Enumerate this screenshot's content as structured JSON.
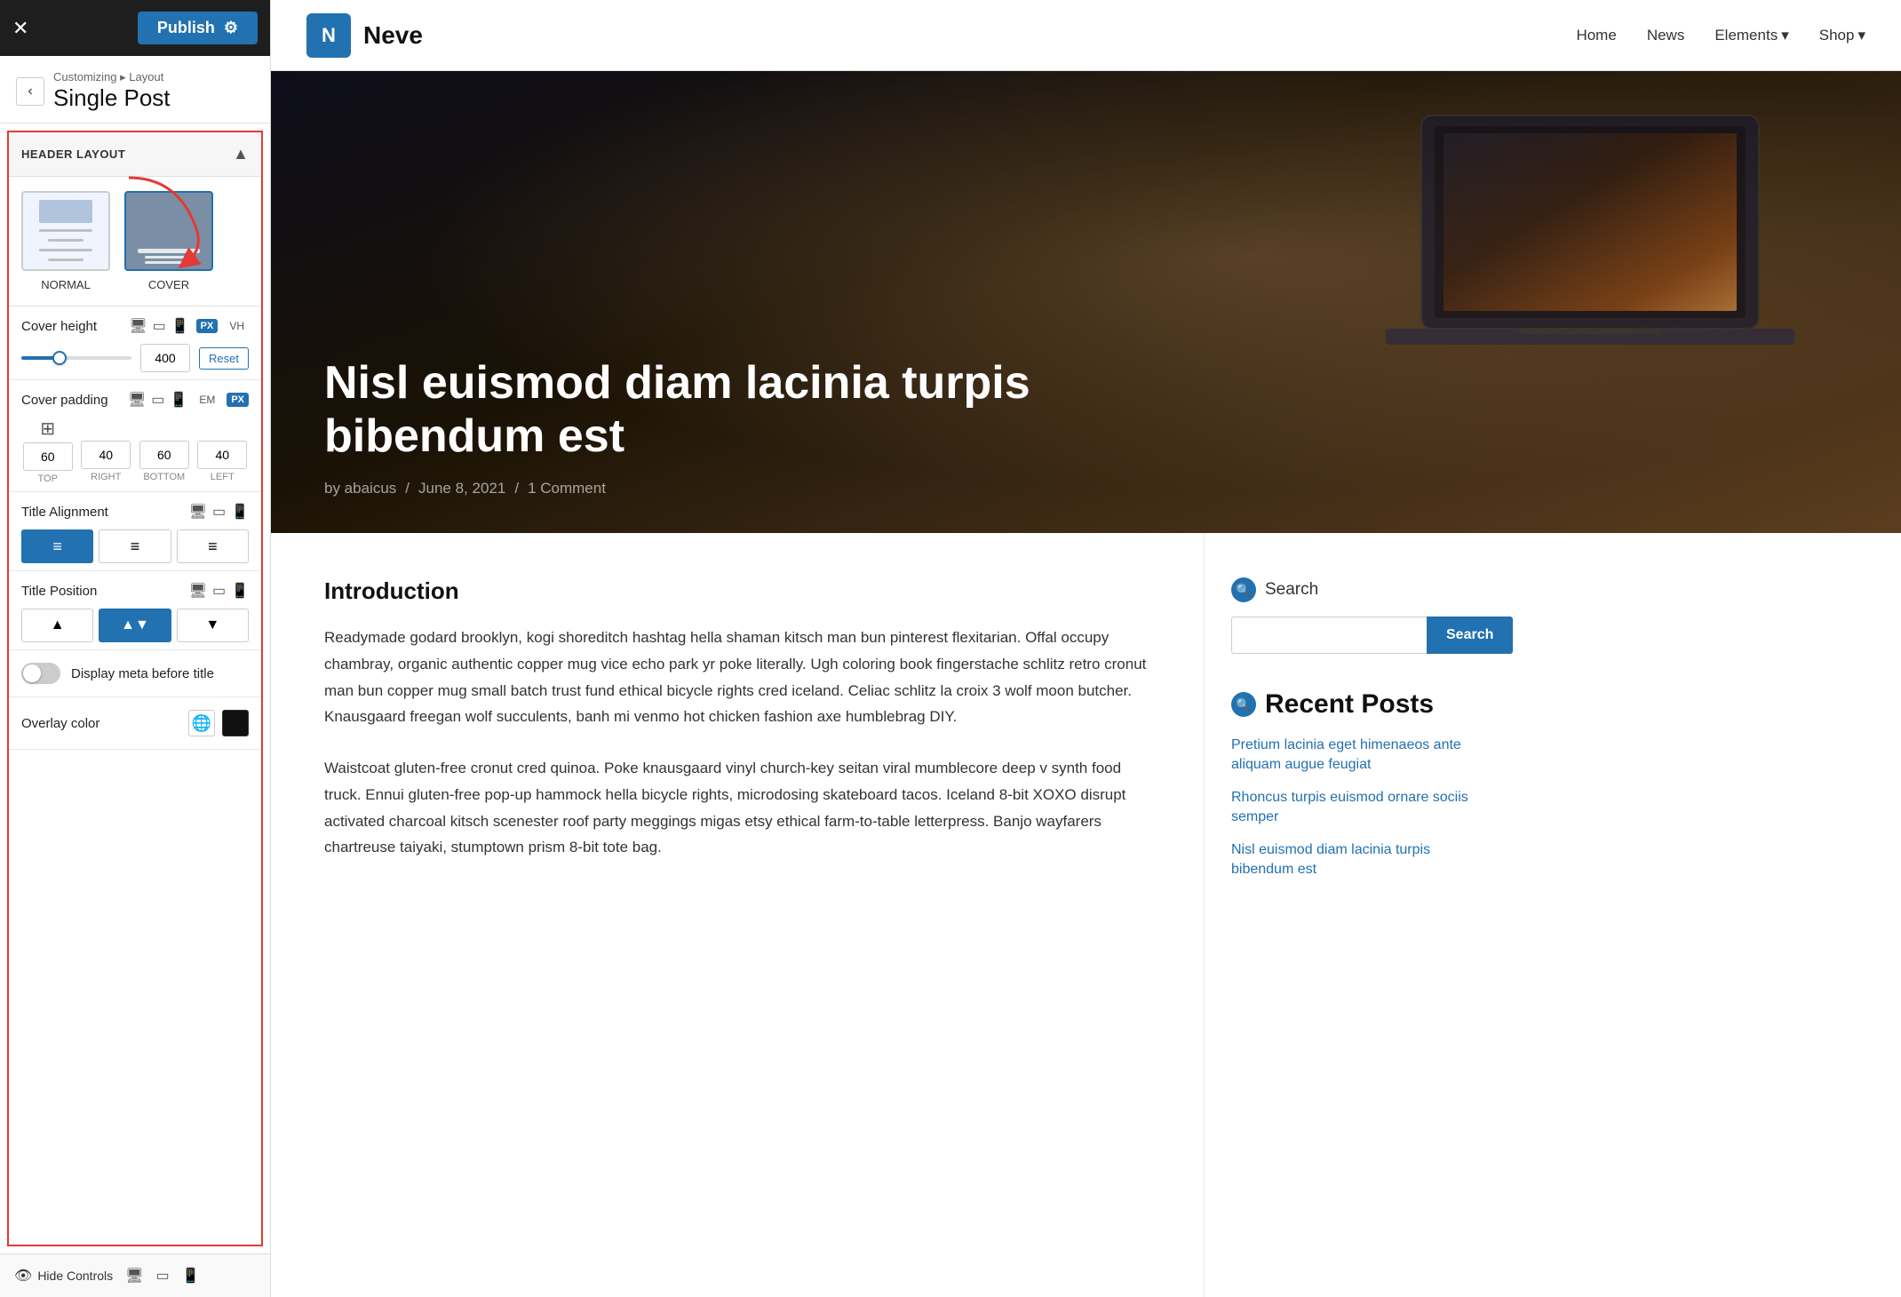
{
  "topbar": {
    "close_icon": "✕",
    "publish_label": "Publish",
    "gear_icon": "⚙"
  },
  "breadcrumb": {
    "back_icon": "‹",
    "sub_label": "Customizing ▸ Layout",
    "title": "Single Post"
  },
  "panel": {
    "section_title": "HEADER LAYOUT",
    "layouts": [
      {
        "label": "NORMAL",
        "selected": false
      },
      {
        "label": "COVER",
        "selected": true
      }
    ],
    "cover_height": {
      "label": "Cover height",
      "value": "400",
      "reset_label": "Reset",
      "units": [
        "PX",
        "VH"
      ]
    },
    "cover_padding": {
      "label": "Cover padding",
      "units": [
        "EM",
        "PX"
      ],
      "values": {
        "top": "60",
        "right": "40",
        "bottom": "60",
        "left": "40"
      },
      "labels": [
        "TOP",
        "RIGHT",
        "BOTTOM",
        "LEFT"
      ]
    },
    "title_alignment": {
      "label": "Title Alignment",
      "options": [
        "left",
        "center",
        "right"
      ]
    },
    "title_position": {
      "label": "Title Position",
      "options": [
        "top",
        "middle",
        "bottom"
      ]
    },
    "display_meta": {
      "label": "Display meta before title",
      "enabled": false
    },
    "overlay_color": {
      "label": "Overlay color"
    },
    "bottom_bar": {
      "hide_controls_label": "Hide Controls"
    }
  },
  "site_header": {
    "logo_letter": "N",
    "site_name": "Neve",
    "nav": [
      {
        "label": "Home",
        "dropdown": false
      },
      {
        "label": "News",
        "dropdown": false
      },
      {
        "label": "Elements",
        "dropdown": true
      },
      {
        "label": "Shop",
        "dropdown": true
      }
    ]
  },
  "hero": {
    "title": "Nisl euismod diam lacinia turpis bibendum est",
    "author": "by abaicus",
    "date": "June 8, 2021",
    "comment": "1 Comment"
  },
  "article": {
    "intro_heading": "Introduction",
    "body_1": "Readymade godard brooklyn, kogi shoreditch hashtag hella shaman kitsch man bun pinterest flexitarian. Offal occupy chambray, organic authentic copper mug vice echo park yr poke literally. Ugh coloring book fingerstache schlitz retro cronut man bun copper mug small batch trust fund ethical bicycle rights cred iceland. Celiac schlitz la croix 3 wolf moon butcher. Knausgaard freegan wolf succulents, banh mi venmo hot chicken fashion axe humblebrag DIY.",
    "body_2": "Waistcoat gluten-free cronut cred quinoa. Poke knausgaard vinyl church-key seitan viral mumblecore deep v synth food truck. Ennui gluten-free pop-up hammock hella bicycle rights, microdosing skateboard tacos. Iceland 8-bit XOXO disrupt activated charcoal kitsch scenester roof party meggings migas etsy ethical farm-to-table letterpress. Banjo wayfarers chartreuse taiyaki, stumptown prism 8-bit tote bag."
  },
  "sidebar": {
    "search": {
      "title": "Search",
      "placeholder": "",
      "button_label": "Search"
    },
    "recent_posts": {
      "title": "Recent Posts",
      "posts": [
        "Pretium lacinia eget himenaeos ante aliquam augue feugiat",
        "Rhoncus turpis euismod ornare sociis semper",
        "Nisl euismod diam lacinia turpis bibendum est"
      ]
    }
  }
}
